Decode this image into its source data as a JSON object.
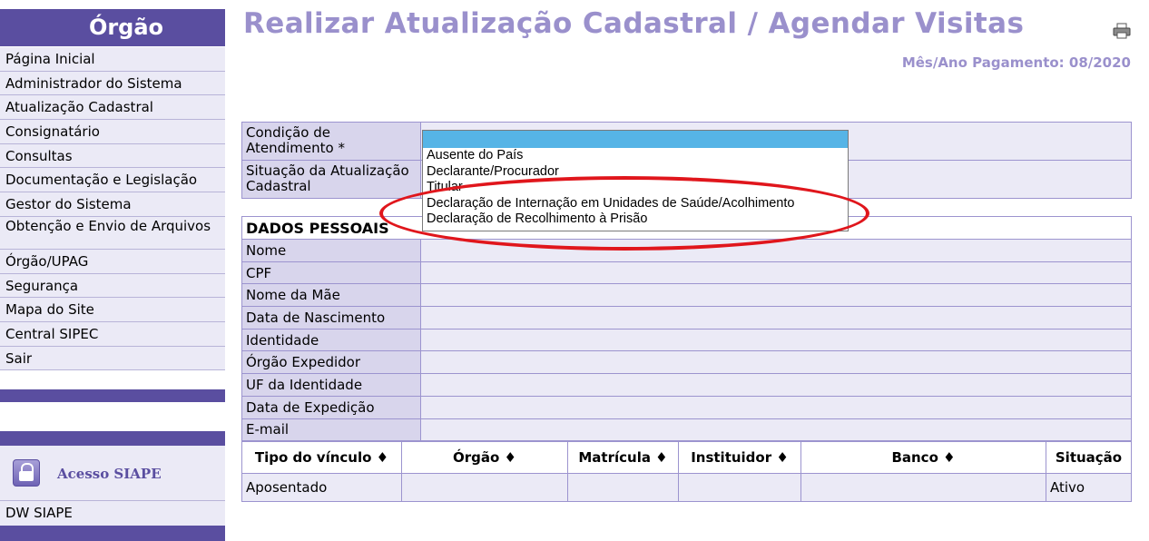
{
  "sidebar": {
    "header": "Órgão",
    "items": [
      {
        "label": "Página Inicial"
      },
      {
        "label": "Administrador do Sistema"
      },
      {
        "label": "Atualização Cadastral"
      },
      {
        "label": "Consignatário"
      },
      {
        "label": "Consultas"
      },
      {
        "label": "Documentação e Legislação"
      },
      {
        "label": "Gestor do Sistema"
      },
      {
        "label": "Obtenção e Envio de Arquivos"
      },
      {
        "label": "Órgão/UPAG"
      },
      {
        "label": "Segurança"
      },
      {
        "label": "Mapa do Site"
      },
      {
        "label": "Central SIPEC"
      },
      {
        "label": "Sair"
      }
    ],
    "access_label": "Acesso SIAPE",
    "dw_label": "DW SIAPE"
  },
  "page": {
    "title": "Realizar Atualização Cadastral / Agendar Visitas",
    "period": "Mês/Ano Pagamento: 08/2020",
    "print_icon": "printer-icon"
  },
  "form": {
    "condition_label": "Condição de Atendimento *",
    "situation_label": "Situação da Atualização Cadastral"
  },
  "dropdown": {
    "options": [
      "",
      "Ausente do País",
      "Declarante/Procurador",
      "Titular",
      "Declaração de Internação em Unidades de Saúde/Acolhimento",
      "Declaração de Recolhimento à Prisão"
    ]
  },
  "personal": {
    "header": "DADOS PESSOAIS",
    "fields": [
      "Nome",
      "CPF",
      "Nome da Mãe",
      "Data de Nascimento",
      "Identidade",
      "Órgão Expedidor",
      "UF da Identidade",
      "Data de Expedição",
      "E-mail"
    ]
  },
  "links_table": {
    "headers": [
      "Tipo do vínculo ♦",
      "Órgão ♦",
      "Matrícula ♦",
      "Instituidor ♦",
      "Banco ♦",
      "Situação"
    ],
    "rows": [
      [
        "Aposentado",
        "",
        "",
        "",
        "",
        "Ativo"
      ]
    ]
  },
  "colors": {
    "accent": "#5a4ea0",
    "title": "#9a90cc",
    "highlight": "#56b4e6",
    "annotation": "#e0161c"
  }
}
